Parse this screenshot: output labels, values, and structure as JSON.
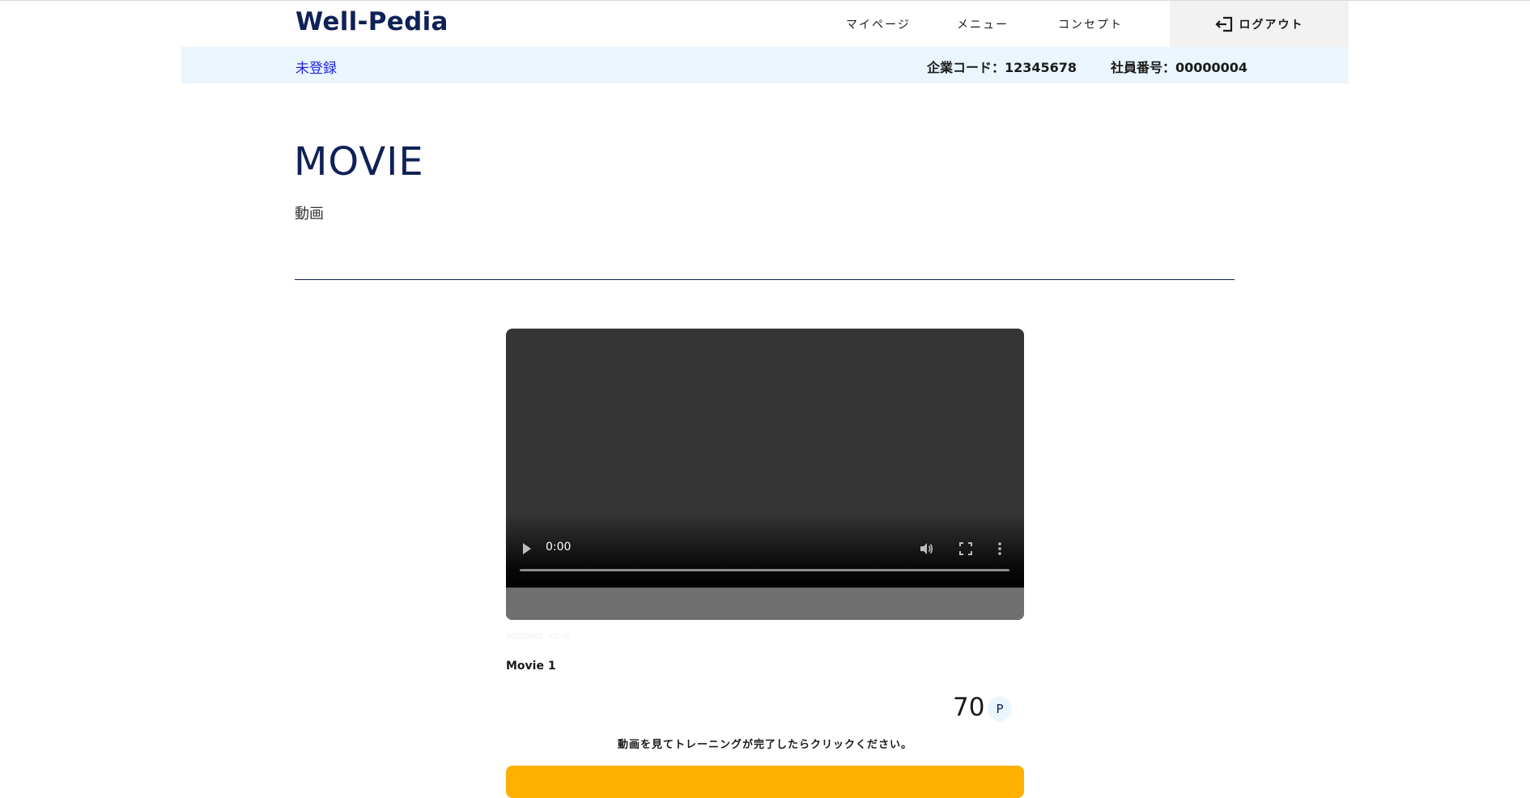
{
  "header": {
    "logo": "Well-Pedia",
    "nav": [
      {
        "label": "マイページ"
      },
      {
        "label": "メニュー"
      },
      {
        "label": "コンセプト"
      }
    ],
    "logout_label": "ログアウト"
  },
  "infobar": {
    "status": "未登録",
    "company_code": "企業コード：12345678",
    "employee_number": "社員番号：00000004"
  },
  "page": {
    "title": "MOVIE",
    "subtitle": "動画"
  },
  "video": {
    "current_time": "0:00",
    "progress": 0,
    "faint_text": "00000000 · 00:00"
  },
  "movie": {
    "title": "Movie 1",
    "points": "70",
    "points_unit": "P",
    "instruction": "動画を見てトレーニングが完了したらクリックください。"
  },
  "colors": {
    "brand": "#0f2157",
    "infobar_bg": "#eaf5fd",
    "link": "#2222ee",
    "button": "#ffb000"
  },
  "icons": {
    "logout": "logout-icon",
    "play": "play-icon",
    "volume": "volume-icon",
    "fullscreen": "fullscreen-icon",
    "more": "more-vertical-icon"
  }
}
